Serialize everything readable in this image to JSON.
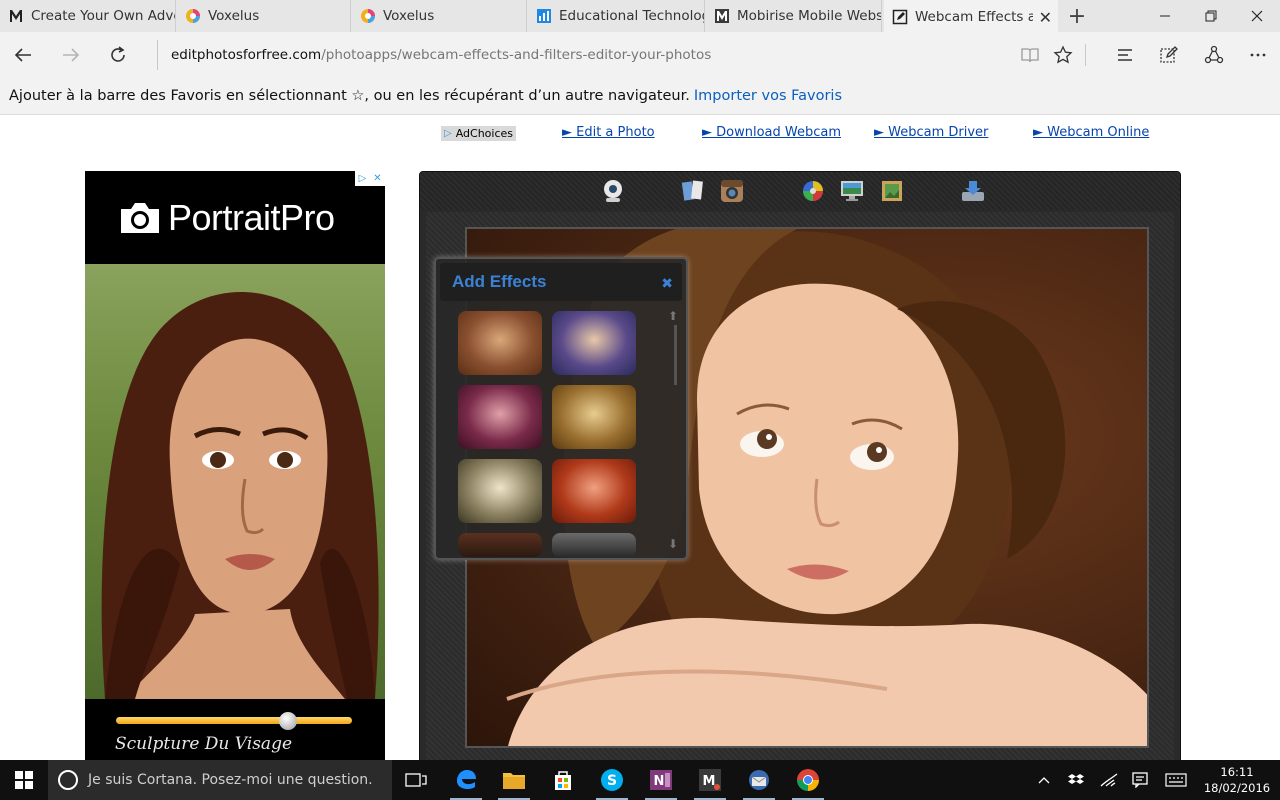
{
  "browser": {
    "tabs": [
      {
        "label": "Create Your Own Adver",
        "icon": "m-icon",
        "active": false
      },
      {
        "label": "Voxelus",
        "icon": "voxelus-icon",
        "active": false
      },
      {
        "label": "Voxelus",
        "icon": "voxelus-icon",
        "active": false
      },
      {
        "label": "Educational Technology",
        "icon": "chart-icon",
        "active": false
      },
      {
        "label": "Mobirise Mobile Websit",
        "icon": "mobirise-icon",
        "active": false
      },
      {
        "label": "Webcam Effects and",
        "icon": "edit-page-icon",
        "active": true
      }
    ],
    "new_tab": "+",
    "url_domain": "editphotosforfree.com",
    "url_path": "/photoapps/webcam-effects-and-filters-editor-your-photos",
    "window_controls": {
      "minimize": "—",
      "restore": "❐",
      "close": "✕"
    }
  },
  "favorites_bar": {
    "message": "Ajouter à la barre des Favoris en sélectionnant ☆, ou en les récupérant d’un autre navigateur.",
    "import_link": "Importer vos Favoris"
  },
  "page": {
    "adchoices": "AdChoices",
    "links": [
      {
        "label": "► Edit a Photo"
      },
      {
        "label": "► Download Webcam"
      },
      {
        "label": "► Webcam Driver"
      },
      {
        "label": "► Webcam Online"
      }
    ],
    "ad": {
      "brand": "PortraitPro",
      "tagline": "Sculpture Du Visage",
      "slider_level": 0.82
    },
    "editor": {
      "tools": [
        "webcam-icon",
        "collage-icon",
        "instagram-icon",
        "color-wheel-icon",
        "monitor-icon",
        "frame-icon",
        "save-icon"
      ],
      "effects_panel": {
        "title": "Add Effects",
        "close": "✖",
        "thumbnails": [
          "sepia",
          "blue-tone",
          "magenta-tone",
          "gold-tone",
          "pale-vintage",
          "red-tone",
          "dark-vintage",
          "cool-dark"
        ]
      }
    }
  },
  "taskbar": {
    "cortana_placeholder": "Je suis Cortana. Posez-moi une question.",
    "apps": [
      "task-view-icon",
      "edge-icon",
      "file-explorer-icon",
      "store-icon",
      "skype-icon",
      "onenote-icon",
      "mobirise-icon",
      "thunderbird-icon",
      "chrome-icon"
    ],
    "time": "16:11",
    "date": "18/02/2016"
  },
  "colors": {
    "link": "#0645ad",
    "import_link": "#0a5fbf",
    "effects_title": "#3b82d6",
    "taskbar": "#101010"
  }
}
